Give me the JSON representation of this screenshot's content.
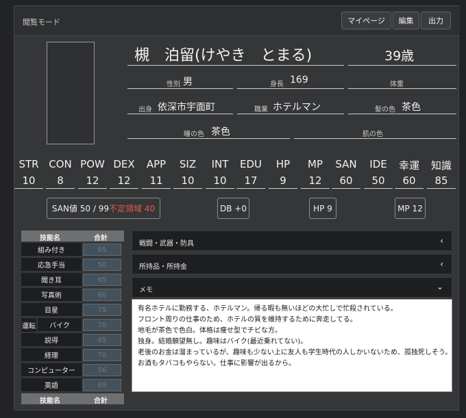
{
  "header": {
    "mode": "閲覧モード",
    "buttons": [
      "マイページ",
      "編集",
      "出力"
    ]
  },
  "character": {
    "name": "槻　泊留(けやき　とまる)",
    "age": "39歳",
    "fields": {
      "sex_label": "性別",
      "sex": "男",
      "height_label": "身長",
      "height": "169",
      "weight_label": "体重",
      "weight": "",
      "birthplace_label": "出身",
      "birthplace": "依深市宇面町",
      "job_label": "職業",
      "job": "ホテルマン",
      "hair_label": "髪の色",
      "hair": "茶色",
      "eye_label": "瞳の色",
      "eye": "茶色",
      "skin_label": "肌の色",
      "skin": ""
    }
  },
  "stats": [
    {
      "label": "STR",
      "value": "10"
    },
    {
      "label": "CON",
      "value": "8"
    },
    {
      "label": "POW",
      "value": "12"
    },
    {
      "label": "DEX",
      "value": "12"
    },
    {
      "label": "APP",
      "value": "11"
    },
    {
      "label": "SIZ",
      "value": "10"
    },
    {
      "label": "INT",
      "value": "10"
    },
    {
      "label": "EDU",
      "value": "17"
    },
    {
      "label": "HP",
      "value": "9"
    },
    {
      "label": "MP",
      "value": "12"
    },
    {
      "label": "SAN",
      "value": "60"
    },
    {
      "label": "IDE",
      "value": "50"
    },
    {
      "label": "幸運",
      "value": "60"
    },
    {
      "label": "知識",
      "value": "85"
    }
  ],
  "pills": {
    "san_prefix": "SAN値 50 / 99",
    "san_red": "不定領域 40",
    "db": "DB +0",
    "hp": "HP 9",
    "mp": "MP 12"
  },
  "skills": {
    "header_name": "技能名",
    "header_total": "合計",
    "rows": [
      {
        "name": "組み付き",
        "total": "65"
      },
      {
        "name": "応急手当",
        "total": "50"
      },
      {
        "name": "聞き耳",
        "total": "65"
      },
      {
        "name": "写真術",
        "total": "60"
      },
      {
        "name": "目星",
        "total": "75"
      },
      {
        "name": "バイク",
        "total": "70"
      },
      {
        "name": "説得",
        "total": "65"
      },
      {
        "name": "経理",
        "total": "70"
      },
      {
        "name": "コンピューター",
        "total": "56"
      },
      {
        "name": "英語",
        "total": "69"
      }
    ],
    "bike_group": "運転"
  },
  "sections": {
    "combat": "戦闘・武器・防具",
    "items": "所持品・所持金",
    "memo": "メモ"
  },
  "memo_lines": [
    "有名ホテルに勤務する、ホテルマン。帰る暇も無いほどの大忙しで忙殺されている。",
    "フロント周りの仕事のため、ホテルの質を維持するために奔走してる。",
    "地毛が茶色で色白。体格は痩せ型でチビな方。",
    "独身。結婚願望無し。趣味はバイク(最近乗れてない)。",
    "老後のお金は溜まっているが、趣味も少ない上に友人も学生時代の人しかいないため、孤独死しそう。",
    "お酒もタバコもやらない。仕事に影響が出るから。"
  ]
}
